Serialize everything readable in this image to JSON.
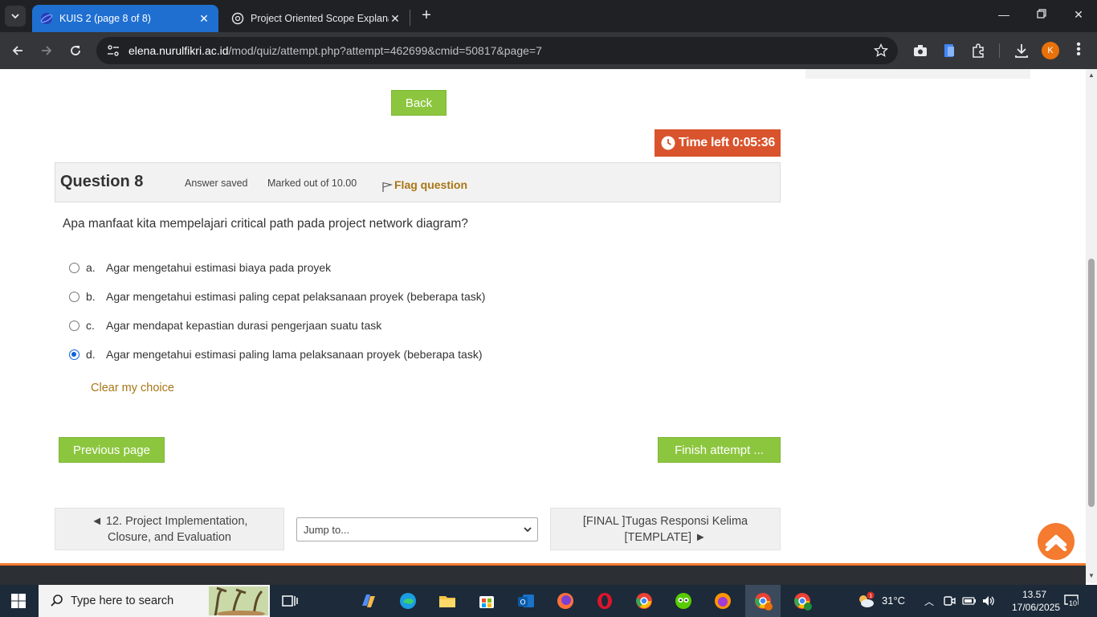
{
  "browser": {
    "tabs": [
      {
        "title": "KUIS 2 (page 8 of 8)",
        "active": true
      },
      {
        "title": "Project Oriented Scope Explana",
        "active": false
      }
    ],
    "url_host": "elena.nurulfikri.ac.id",
    "url_path": "/mod/quiz/attempt.php?attempt=462699&cmid=50817&page=7",
    "profile_initial": "K"
  },
  "quiz": {
    "back_label": "Back",
    "time_left": "Time left 0:05:36",
    "question_number_label": "Question 8",
    "state": "Answer saved",
    "grade": "Marked out of 10.00",
    "flag_label": "Flag question",
    "question_text": "Apa manfaat kita mempelajari critical path pada project network diagram?",
    "answers": [
      {
        "letter": "a.",
        "text": "Agar mengetahui estimasi biaya pada proyek",
        "selected": false
      },
      {
        "letter": "b.",
        "text": "Agar mengetahui estimasi paling cepat pelaksanaan proyek (beberapa task)",
        "selected": false
      },
      {
        "letter": "c.",
        "text": "Agar mendapat kepastian durasi pengerjaan suatu task",
        "selected": false
      },
      {
        "letter": "d.",
        "text": "Agar mengetahui estimasi paling lama pelaksanaan proyek (beberapa task)",
        "selected": true
      }
    ],
    "clear_choice": "Clear my choice",
    "previous_page": "Previous page",
    "finish_attempt": "Finish attempt ..."
  },
  "activity_nav": {
    "prev_line1": "◄ 12. Project Implementation,",
    "prev_line2": "Closure, and Evaluation",
    "jump_to": "Jump to...",
    "next_line1": "[FINAL ]Tugas Responsi Kelima",
    "next_line2": "[TEMPLATE] ►"
  },
  "taskbar": {
    "search_placeholder": "Type here to search",
    "weather": "31°C",
    "time": "13.57",
    "date": "17/06/2025",
    "notification_count": "10",
    "weather_badge": "1"
  },
  "colors": {
    "accent_green": "#8cc63f",
    "timer_red": "#d9532c",
    "link_gold": "#a87614",
    "scroll_orange": "#f47b2f"
  }
}
